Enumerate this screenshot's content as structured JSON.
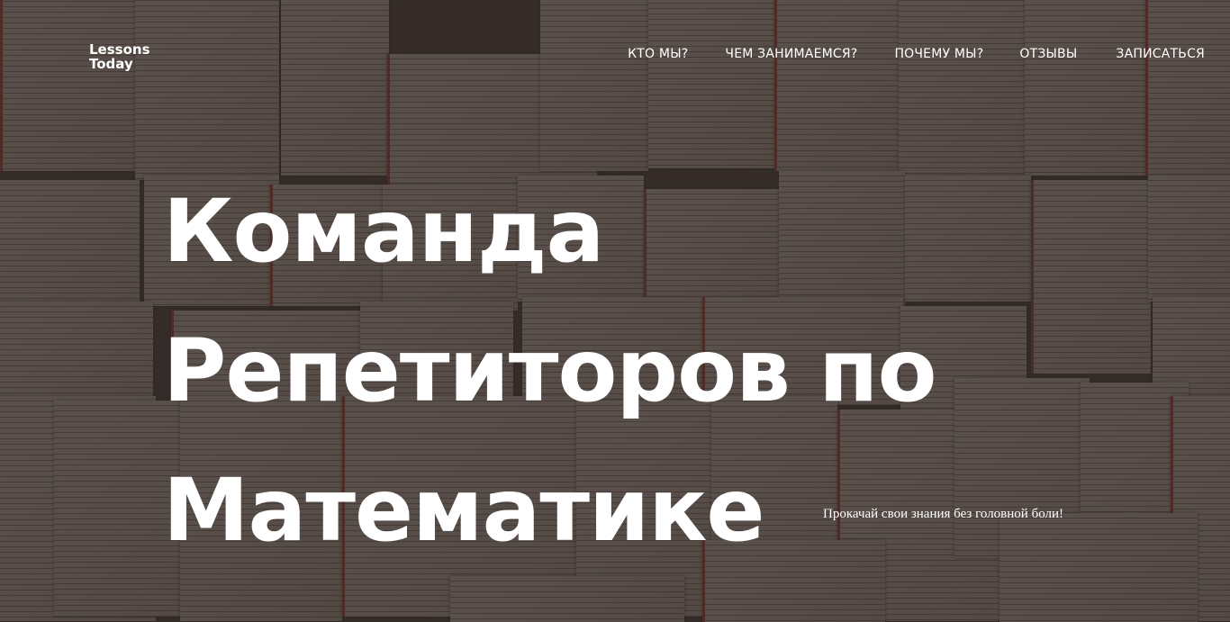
{
  "header": {
    "logo_line1": "Lessons",
    "logo_line2": "Today",
    "nav": [
      {
        "label": "КТО МЫ?"
      },
      {
        "label": "ЧЕМ ЗАНИМАЕМСЯ?"
      },
      {
        "label": "ПОЧЕМУ МЫ?"
      },
      {
        "label": "ОТЗЫВЫ"
      },
      {
        "label": "ЗАПИСАТЬСЯ"
      }
    ]
  },
  "hero": {
    "title_line1": "Команда",
    "title_line2": "Репетиторов по",
    "title_line3": "Математике",
    "tagline": "Прокачай свои знания без головной боли!"
  },
  "colors": {
    "text": "#ffffff",
    "overlay": "#302624",
    "paper": "#e8ddd0",
    "accent_red": "#b3402f"
  }
}
